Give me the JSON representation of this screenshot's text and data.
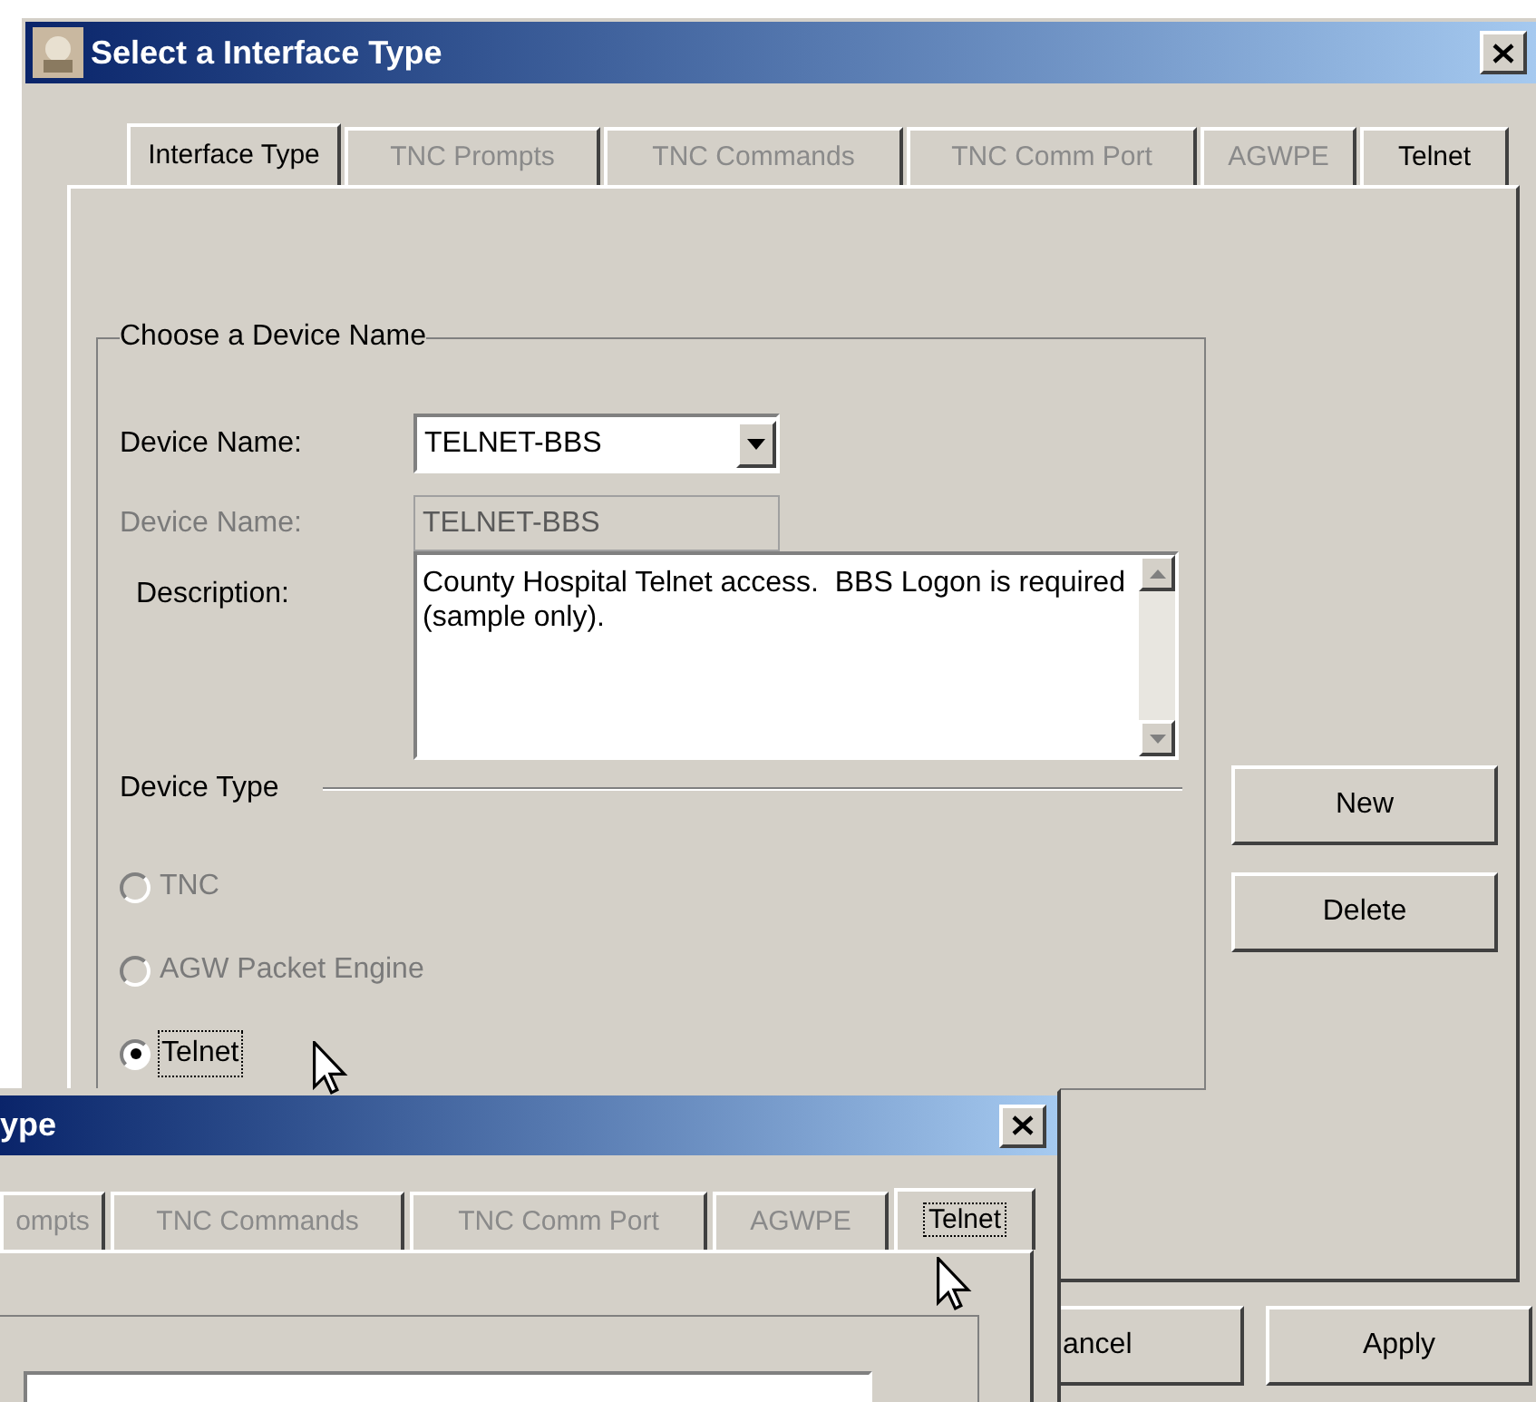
{
  "main_window": {
    "title": "Select a Interface Type",
    "tabs": [
      {
        "label": "Interface Type",
        "selected": true,
        "disabled": false,
        "focused": false
      },
      {
        "label": "TNC Prompts",
        "selected": false,
        "disabled": true,
        "focused": false
      },
      {
        "label": "TNC Commands",
        "selected": false,
        "disabled": true,
        "focused": false
      },
      {
        "label": "TNC Comm Port",
        "selected": false,
        "disabled": true,
        "focused": false
      },
      {
        "label": "AGWPE",
        "selected": false,
        "disabled": true,
        "focused": false
      },
      {
        "label": "Telnet",
        "selected": false,
        "disabled": false,
        "focused": false
      }
    ],
    "device_group": {
      "title": "Choose a Device Name",
      "device_name": {
        "label": "Device Name:",
        "value": "TELNET-BBS",
        "disabled": false
      },
      "device_name_copy": {
        "label": "Device Name:",
        "value": "TELNET-BBS",
        "disabled": true
      },
      "description": {
        "label": "Description:",
        "value": "County Hospital Telnet access.  BBS Logon is required (sample only)."
      },
      "device_type": {
        "label": "Device Type",
        "options": [
          {
            "label": "TNC",
            "selected": false,
            "disabled": true,
            "focused": false
          },
          {
            "label": "AGW Packet Engine",
            "selected": false,
            "disabled": true,
            "focused": false
          },
          {
            "label": "Telnet",
            "selected": true,
            "disabled": false,
            "focused": true
          }
        ]
      }
    },
    "side_buttons": [
      "New",
      "Delete"
    ],
    "footer_buttons": [
      "ancel",
      "Apply"
    ]
  },
  "second_window": {
    "title": "ype",
    "tabs": [
      {
        "label": "ompts",
        "selected": false,
        "disabled": true,
        "focused": false
      },
      {
        "label": "TNC Commands",
        "selected": false,
        "disabled": true,
        "focused": false
      },
      {
        "label": "TNC Comm Port",
        "selected": false,
        "disabled": true,
        "focused": false
      },
      {
        "label": "AGWPE",
        "selected": false,
        "disabled": true,
        "focused": false
      },
      {
        "label": "Telnet",
        "selected": true,
        "disabled": false,
        "focused": true
      }
    ]
  }
}
